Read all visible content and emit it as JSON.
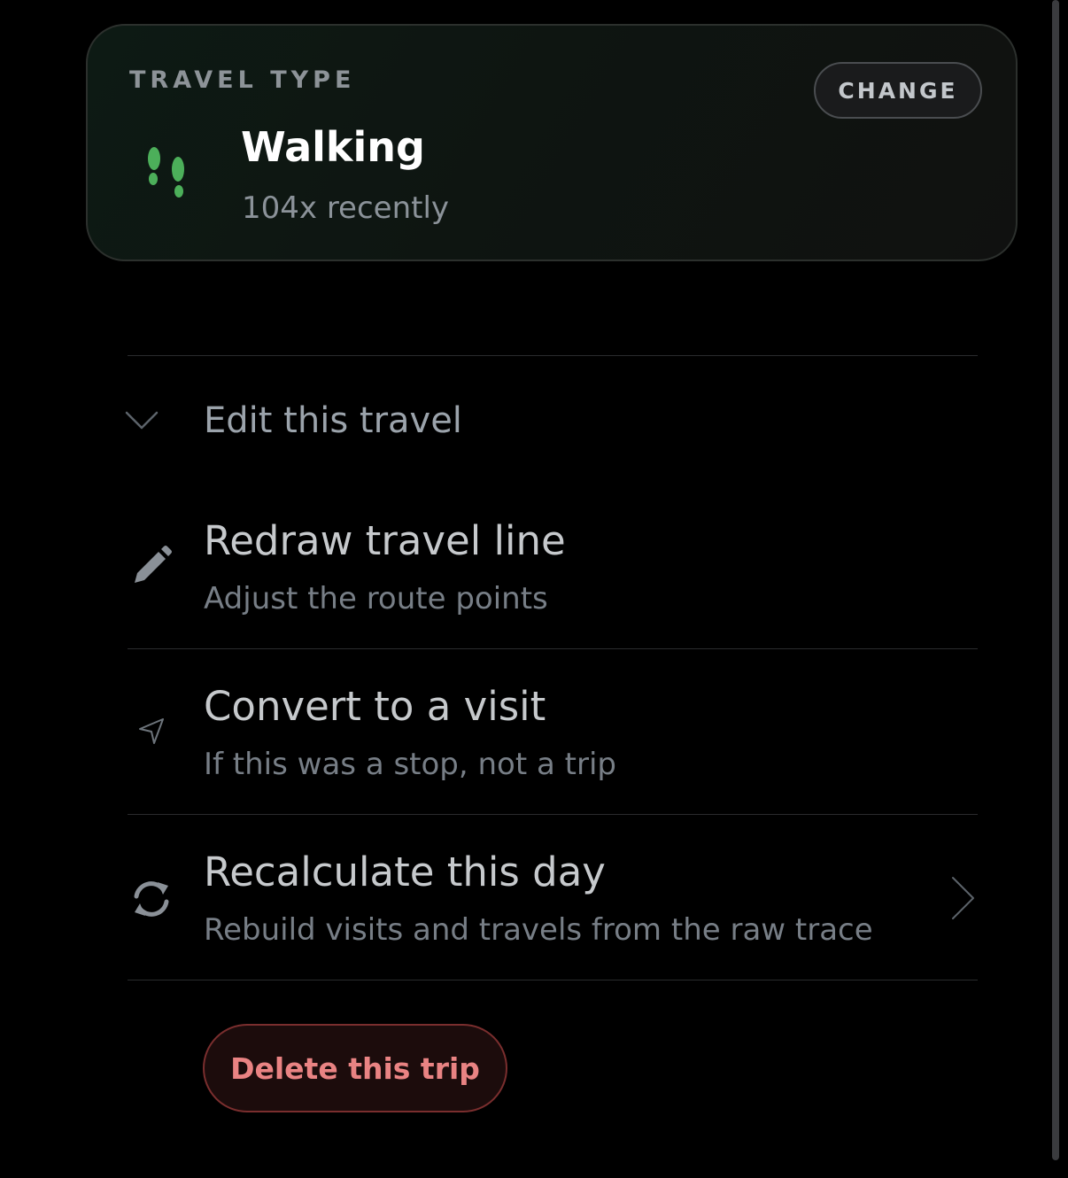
{
  "travel_card": {
    "label": "TRAVEL TYPE",
    "change_label": "CHANGE",
    "mode": "Walking",
    "mode_icon": "footprints-icon",
    "usage": "104x recently",
    "accent_color": "#4caf5a"
  },
  "edit_section": {
    "label": "Edit this travel",
    "icon": "chevron-down-icon",
    "expanded": true
  },
  "actions": [
    {
      "title": "Redraw travel line",
      "subtitle": "Adjust the route points",
      "icon": "pencil-icon"
    },
    {
      "title": "Convert to a visit",
      "subtitle": "If this was a stop, not a trip",
      "icon": "location-arrow-icon"
    },
    {
      "title": "Recalculate this day",
      "subtitle": "Rebuild visits and travels from the raw trace",
      "icon": "refresh-icon",
      "trailing_icon": "chevron-right-icon"
    }
  ],
  "delete_label": "Delete this trip",
  "colors": {
    "background": "#000000",
    "danger": "#e98383"
  }
}
